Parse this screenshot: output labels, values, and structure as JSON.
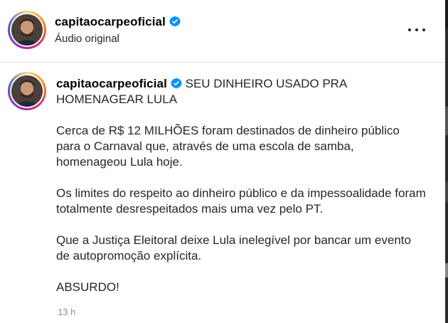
{
  "header": {
    "username": "capitaocarpeoficial",
    "subtitle": "Áudio original",
    "more_icon": "more-horizontal-icon"
  },
  "post": {
    "username": "capitaocarpeoficial",
    "caption_title": " SEU DINHEIRO USADO PRA HOMENAGEAR LULA",
    "paragraphs": [
      "Cerca de R$ 12 MILHÕES foram destinados de dinheiro público para o Carnaval que, através de uma escola de samba, homenageou Lula hoje.",
      "Os limites do respeito ao dinheiro público e da impessoalidade foram totalmente desrespeitados mais uma vez pelo PT.",
      "Que a Justiça Eleitoral deixe Lula inelegível por bancar um evento de autopromoção explícita.",
      "ABSURDO!"
    ],
    "timestamp": "13 h"
  },
  "colors": {
    "verified_blue": "#0095f6",
    "text": "#262626",
    "muted": "#8e8e8e",
    "divider": "#dbdbdb"
  }
}
